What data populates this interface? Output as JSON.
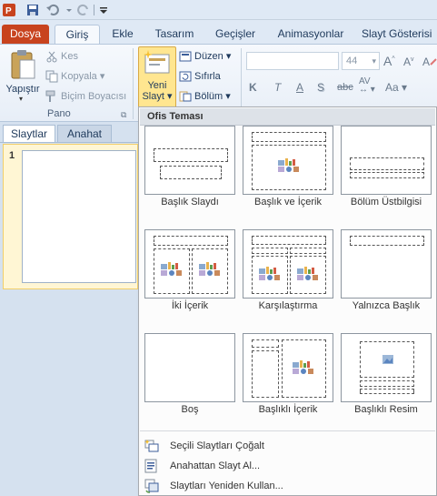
{
  "tabs": [
    "Dosya",
    "Giriş",
    "Ekle",
    "Tasarım",
    "Geçişler",
    "Animasyonlar",
    "Slayt Gösterisi"
  ],
  "clipboard": {
    "paste": "Yapıştır",
    "cut": "Kes",
    "copy": "Kopyala",
    "format": "Biçim Boyacısı",
    "group": "Pano"
  },
  "slides": {
    "new_line1": "Yeni",
    "new_line2": "Slayt",
    "layout": "Düzen",
    "reset": "Sıfırla",
    "section": "Bölüm"
  },
  "font": {
    "size": "44"
  },
  "panel": {
    "tab_slides": "Slaytlar",
    "tab_outline": "Anahat",
    "slide_number": "1"
  },
  "menu": {
    "header": "Ofis Teması",
    "layouts": [
      "Başlık Slaydı",
      "Başlık ve İçerik",
      "Bölüm Üstbilgisi",
      "İki İçerik",
      "Karşılaştırma",
      "Yalnızca Başlık",
      "Boş",
      "Başlıklı İçerik",
      "Başlıklı Resim"
    ],
    "items": [
      "Seçili Slaytları Çoğalt",
      "Anahattan Slayt Al...",
      "Slaytları Yeniden Kullan..."
    ]
  },
  "colors": {
    "file_tab": "#c8431e",
    "accent": "#1e395b",
    "selected": "#ffe690"
  }
}
